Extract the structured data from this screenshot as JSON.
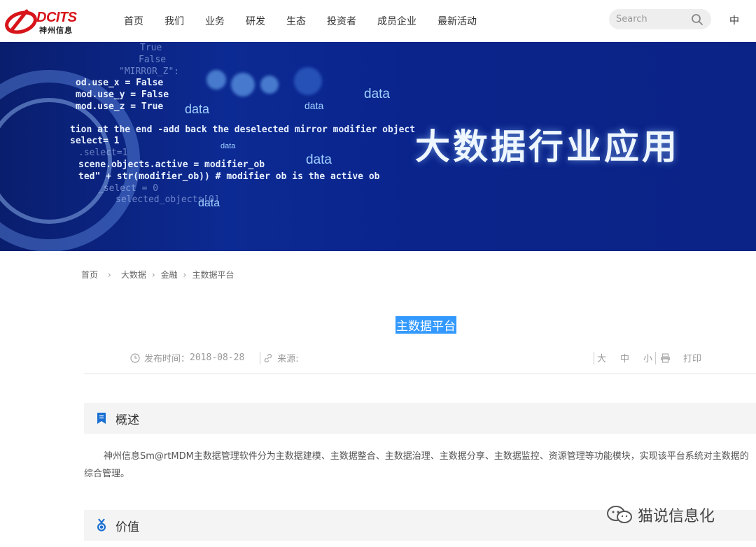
{
  "header": {
    "logo_en": "DCITS",
    "logo_cn": "神州信息",
    "nav": [
      "首页",
      "我们",
      "业务",
      "研发",
      "生态",
      "投资者",
      "成员企业",
      "最新活动"
    ],
    "search_placeholder": "Search",
    "lang": "中"
  },
  "banner": {
    "code": [
      "True",
      "False",
      "\"MIRROR_Z\":",
      "od.use_x = False",
      "mod.use_y = False",
      "mod.use_z = True",
      "tion at the end -add back the deselected mirror modifier object",
      "select= 1",
      ".select=1",
      "scene.objects.active = modifier_ob",
      "ted\" + str(modifier_ob)) # modifier ob is the active ob",
      "_select = 0",
      "selected_objects[0]"
    ],
    "floating_word": "data",
    "title": "大数据行业应用"
  },
  "breadcrumb": [
    "首页",
    "大数据",
    "金融",
    "主数据平台"
  ],
  "article": {
    "title": "主数据平台",
    "publish_label": "发布时间：",
    "publish_date": "2018-08-28",
    "source_label": "来源:",
    "font_large": "大",
    "font_medium": "中",
    "font_small": "小",
    "print": "打印"
  },
  "sections": [
    {
      "title": "概述",
      "body": "神州信息Sm@rtMDM主数据管理软件分为主数据建模、主数据整合、主数据治理、主数据分享、主数据监控、资源管理等功能模块，实现该平台系统对主数据的综合管理。"
    },
    {
      "title": "价值"
    }
  ],
  "watermark": "猫说信息化",
  "colors": {
    "brand_red": "#d7141a",
    "accent_blue": "#1a6fd1",
    "selection": "#3399ff"
  }
}
